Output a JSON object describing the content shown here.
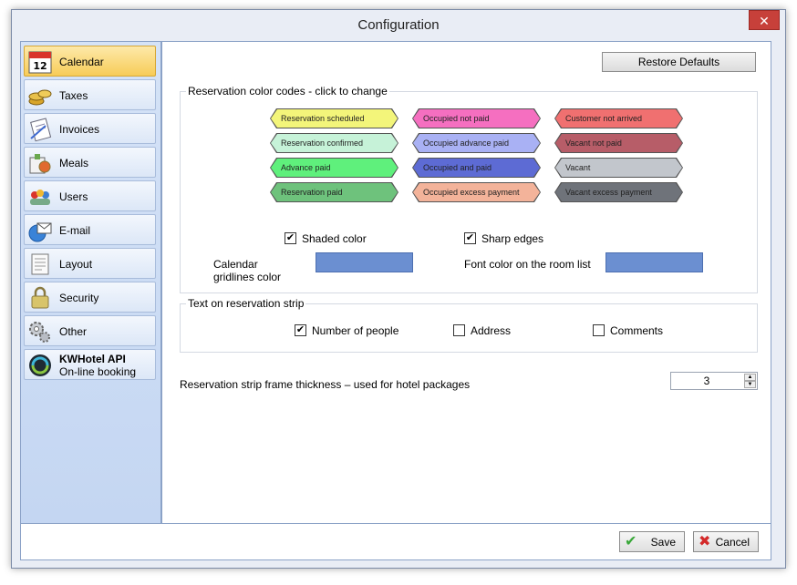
{
  "window": {
    "title": "Configuration",
    "close_glyph": "✕"
  },
  "sidebar": {
    "items": [
      {
        "label": "Calendar",
        "icon": "calendar-icon"
      },
      {
        "label": "Taxes",
        "icon": "coins-icon"
      },
      {
        "label": "Invoices",
        "icon": "invoice-icon"
      },
      {
        "label": "Meals",
        "icon": "meals-icon"
      },
      {
        "label": "Users",
        "icon": "users-icon"
      },
      {
        "label": "E-mail",
        "icon": "email-icon"
      },
      {
        "label": "Layout",
        "icon": "layout-icon"
      },
      {
        "label": "Security",
        "icon": "lock-icon"
      },
      {
        "label": "Other",
        "icon": "gears-icon"
      }
    ],
    "api": {
      "title": "KWHotel API",
      "subtitle": "On-line booking",
      "icon": "globe-icon"
    }
  },
  "main": {
    "restore_label": "Restore Defaults",
    "color_group_title": "Reservation color codes - click to change",
    "tags": [
      {
        "label": "Reservation scheduled",
        "color": "#f3f57a"
      },
      {
        "label": "Reservation confirmed",
        "color": "#c6f2d8"
      },
      {
        "label": "Advance paid",
        "color": "#5ff07c"
      },
      {
        "label": "Reservation paid",
        "color": "#6ec27c"
      },
      {
        "label": "Occupied not paid",
        "color": "#f56fc0"
      },
      {
        "label": "Occupied advance paid",
        "color": "#a9b1f4"
      },
      {
        "label": "Occupied and paid",
        "color": "#5d6bd4"
      },
      {
        "label": "Occupied excess payment",
        "color": "#f3b39a"
      },
      {
        "label": "Customer not arrived",
        "color": "#f07070"
      },
      {
        "label": "Vacant not paid",
        "color": "#b75d68"
      },
      {
        "label": "Vacant",
        "color": "#c2c6cc"
      },
      {
        "label": "Vacant excess payment",
        "color": "#6f737a"
      }
    ],
    "shaded_label": "Shaded color",
    "sharp_label": "Sharp edges",
    "gridlines_label": "Calendar gridlines color",
    "font_color_label": "Font color on the room list",
    "strip_group_title": "Text on reservation strip",
    "people_label": "Number of people",
    "address_label": "Address",
    "comments_label": "Comments",
    "thickness_label": "Reservation strip frame thickness – used for hotel packages",
    "thickness_value": "3",
    "check_glyph": "✔",
    "spin_up_glyph": "▲",
    "spin_down_glyph": "▼"
  },
  "footer": {
    "save_label": "Save",
    "cancel_label": "Cancel",
    "save_glyph": "✔",
    "cancel_glyph": "✖"
  },
  "colors": {
    "swatch": "#6b8fd1",
    "active_nav": "#f7cc58"
  }
}
